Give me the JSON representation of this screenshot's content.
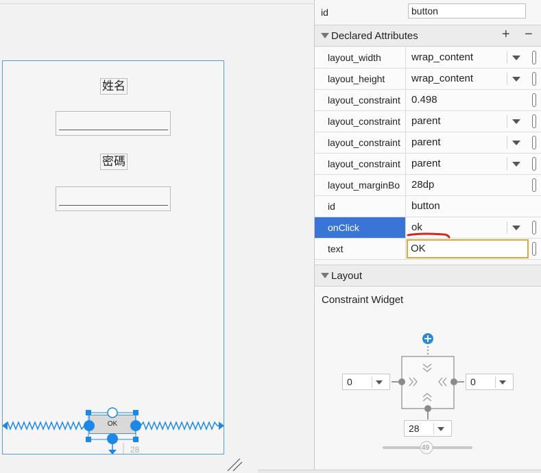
{
  "canvas": {
    "labels": {
      "name": "姓名",
      "password": "密碼"
    },
    "button_text": "OK",
    "bottom_margin_value": "28"
  },
  "panel": {
    "id_row": {
      "label": "id",
      "value": "button"
    },
    "declared": {
      "title": "Declared Attributes",
      "add": "+",
      "remove": "−",
      "rows": [
        {
          "name": "layout_width",
          "value": "wrap_content"
        },
        {
          "name": "layout_height",
          "value": "wrap_content"
        },
        {
          "name": "layout_constraint",
          "value": "0.498"
        },
        {
          "name": "layout_constraint",
          "value": "parent"
        },
        {
          "name": "layout_constraint",
          "value": "parent"
        },
        {
          "name": "layout_constraint",
          "value": "parent"
        },
        {
          "name": "layout_marginBo",
          "value": "28dp"
        },
        {
          "name": "id",
          "value": "button"
        },
        {
          "name": "onClick",
          "value": "ok"
        },
        {
          "name": "text",
          "value": "OK"
        }
      ]
    },
    "layout": {
      "title": "Layout",
      "widget_title": "Constraint Widget",
      "left_margin": "0",
      "right_margin": "0",
      "bottom_margin": "28",
      "bias": "49"
    }
  },
  "colors": {
    "selection": "#3875d7",
    "constraint_blue": "#1e88e5",
    "editor_border": "#e0a63a",
    "annotation_red": "#e02020"
  }
}
